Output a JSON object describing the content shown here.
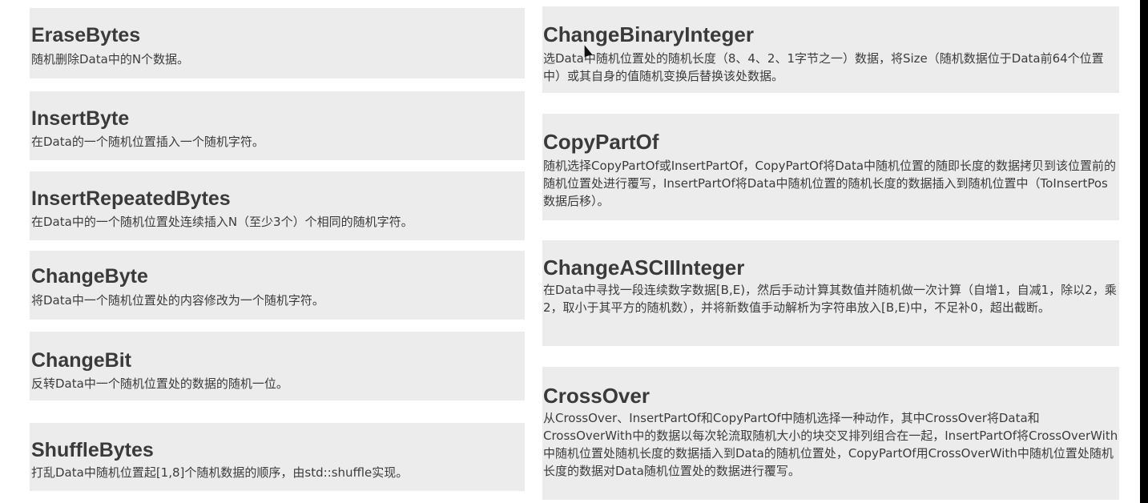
{
  "left": [
    {
      "title": "EraseBytes",
      "desc": "随机删除Data中的N个数据。"
    },
    {
      "title": "InsertByte",
      "desc": "在Data的一个随机位置插入一个随机字符。"
    },
    {
      "title": "InsertRepeatedBytes",
      "desc": "在Data中的一个随机位置处连续插入N（至少3个）个相同的随机字符。"
    },
    {
      "title": "ChangeByte",
      "desc": "将Data中一个随机位置处的内容修改为一个随机字符。"
    },
    {
      "title": "ChangeBit",
      "desc": "反转Data中一个随机位置处的数据的随机一位。"
    },
    {
      "title": "ShuffleBytes",
      "desc": "打乱Data中随机位置起[1,8]个随机数据的顺序，由std::shuffle实现。"
    }
  ],
  "right": [
    {
      "title": "ChangeBinaryInteger",
      "desc": "选Data中随机位置处的随机长度（8、4、2、1字节之一）数据，将Size（随机数据位于Data前64个位置中）或其自身的值随机变换后替换该处数据。"
    },
    {
      "title": "CopyPartOf",
      "desc": "随机选择CopyPartOf或InsertPartOf，CopyPartOf将Data中随机位置的随即长度的数据拷贝到该位置前的随机位置处进行覆写，InsertPartOf将Data中随机位置的随机长度的数据插入到随机位置中（ToInsertPos数据后移）。"
    },
    {
      "title": "ChangeASCIIInteger",
      "desc": "在Data中寻找一段连续数字数据[B,E)，然后手动计算其数值并随机做一次计算（自增1，自减1，除以2，乘2，取小于其平方的随机数），并将新数值手动解析为字符串放入[B,E)中，不足补0，超出截断。"
    },
    {
      "title": "CrossOver",
      "desc": "从CrossOver、InsertPartOf和CopyPartOf中随机选择一种动作，其中CrossOver将Data和CrossOverWith中的数据以每次轮流取随机大小的块交叉排列组合在一起，InsertPartOf将CrossOverWith中随机位置处随机长度的数据插入到Data的随机位置处，CopyPartOf用CrossOverWith中随机位置处随机长度的数据对Data随机位置处的数据进行覆写。"
    }
  ]
}
